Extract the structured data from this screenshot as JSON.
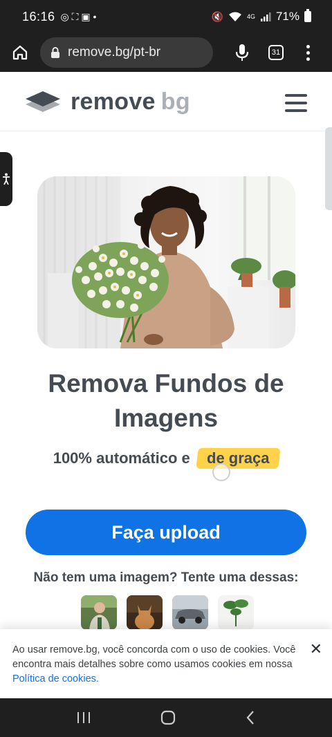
{
  "status_bar": {
    "time": "16:16",
    "battery": "71%",
    "signal_label": "4G"
  },
  "browser": {
    "url": "remove.bg/pt-br",
    "tab_count": "31"
  },
  "header": {
    "logo_word_1": "remove",
    "logo_word_2": "bg"
  },
  "hero": {
    "title": "Remova Fundos de Imagens",
    "subtitle_prefix": "100% automático e",
    "subtitle_highlight": "de graça"
  },
  "upload": {
    "button_label": "Faça upload",
    "try_text": "Não tem uma imagem? Tente uma dessas:"
  },
  "samples": [
    "man-photo",
    "cat-photo",
    "car-photo",
    "plant-photo"
  ],
  "cookie_banner": {
    "text": "Ao usar remove.bg, você concorda com o uso de cookies. Você encontra mais detalhes sobre como usamos cookies em nossa ",
    "link_label": "Política de cookies."
  },
  "colors": {
    "accent": "#0f73e6",
    "highlight": "#ffd24a",
    "text_dark": "#454b52"
  }
}
